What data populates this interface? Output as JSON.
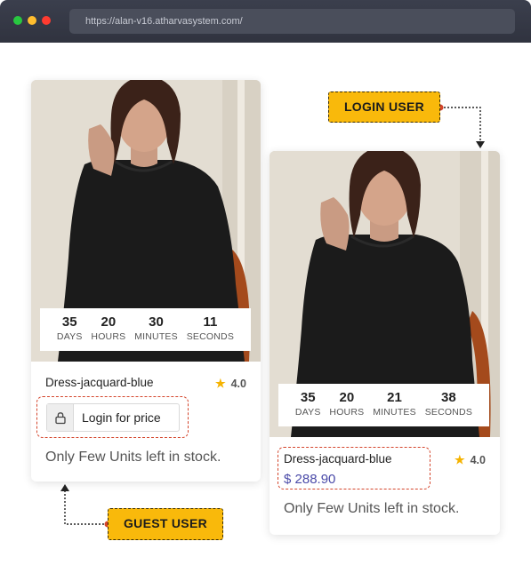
{
  "browser": {
    "url": "https://alan-v16.atharvasystem.com/",
    "colors": {
      "close": "#ff3b30",
      "minimize": "#ffbd2e",
      "maximize": "#28c840"
    }
  },
  "guest_card": {
    "countdown": [
      {
        "value": "35",
        "label": "DAYS"
      },
      {
        "value": "20",
        "label": "HOURS"
      },
      {
        "value": "30",
        "label": "MINUTES"
      },
      {
        "value": "11",
        "label": "SECONDS"
      }
    ],
    "product_name": "Dress-jacquard-blue",
    "rating": "4.0",
    "login_button_label": "Login for price",
    "stock_text": "Only Few Units left in stock."
  },
  "login_card": {
    "countdown": [
      {
        "value": "35",
        "label": "DAYS"
      },
      {
        "value": "20",
        "label": "HOURS"
      },
      {
        "value": "21",
        "label": "MINUTES"
      },
      {
        "value": "38",
        "label": "SECONDS"
      }
    ],
    "product_name": "Dress-jacquard-blue",
    "rating": "4.0",
    "price": "$ 288.90",
    "stock_text": "Only Few Units left in stock."
  },
  "annotations": {
    "login_user_label": "LOGIN USER",
    "guest_user_label": "GUEST USER",
    "highlight_color": "#d4452c",
    "badge_color": "#f9b90b"
  }
}
